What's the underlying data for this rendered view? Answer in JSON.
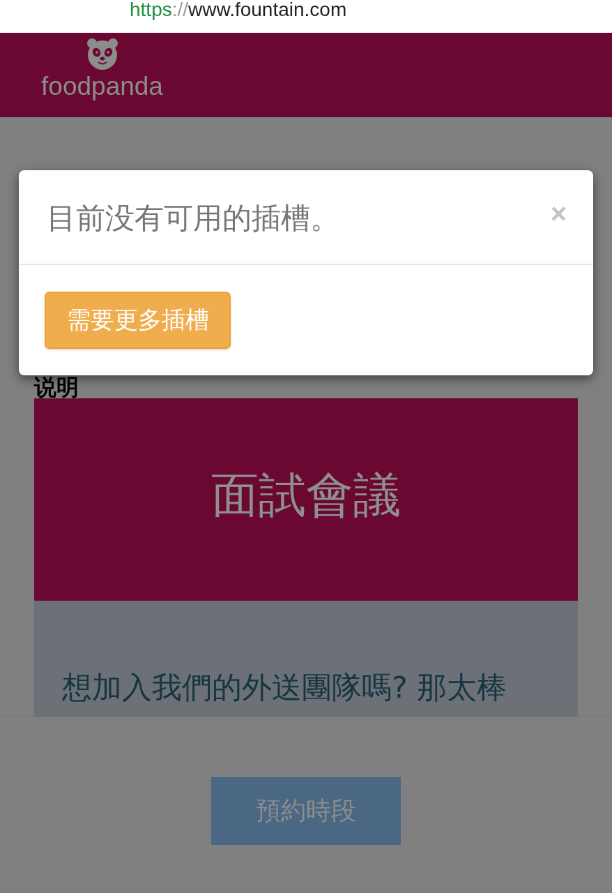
{
  "address_bar": {
    "scheme": "https",
    "separator": "://",
    "host": "www.fountain.com"
  },
  "header": {
    "logo_text": "foodpanda"
  },
  "content": {
    "section_label": "说明",
    "hero": {
      "title": "面試會議"
    },
    "intro": {
      "text": "想加入我們的外送團隊嗎? 那太棒"
    }
  },
  "footer": {
    "button": {
      "label": "預約時段"
    }
  },
  "dialog": {
    "message": "目前没有可用的插槽。",
    "close": "×",
    "action": {
      "label": "需要更多插槽"
    }
  }
}
